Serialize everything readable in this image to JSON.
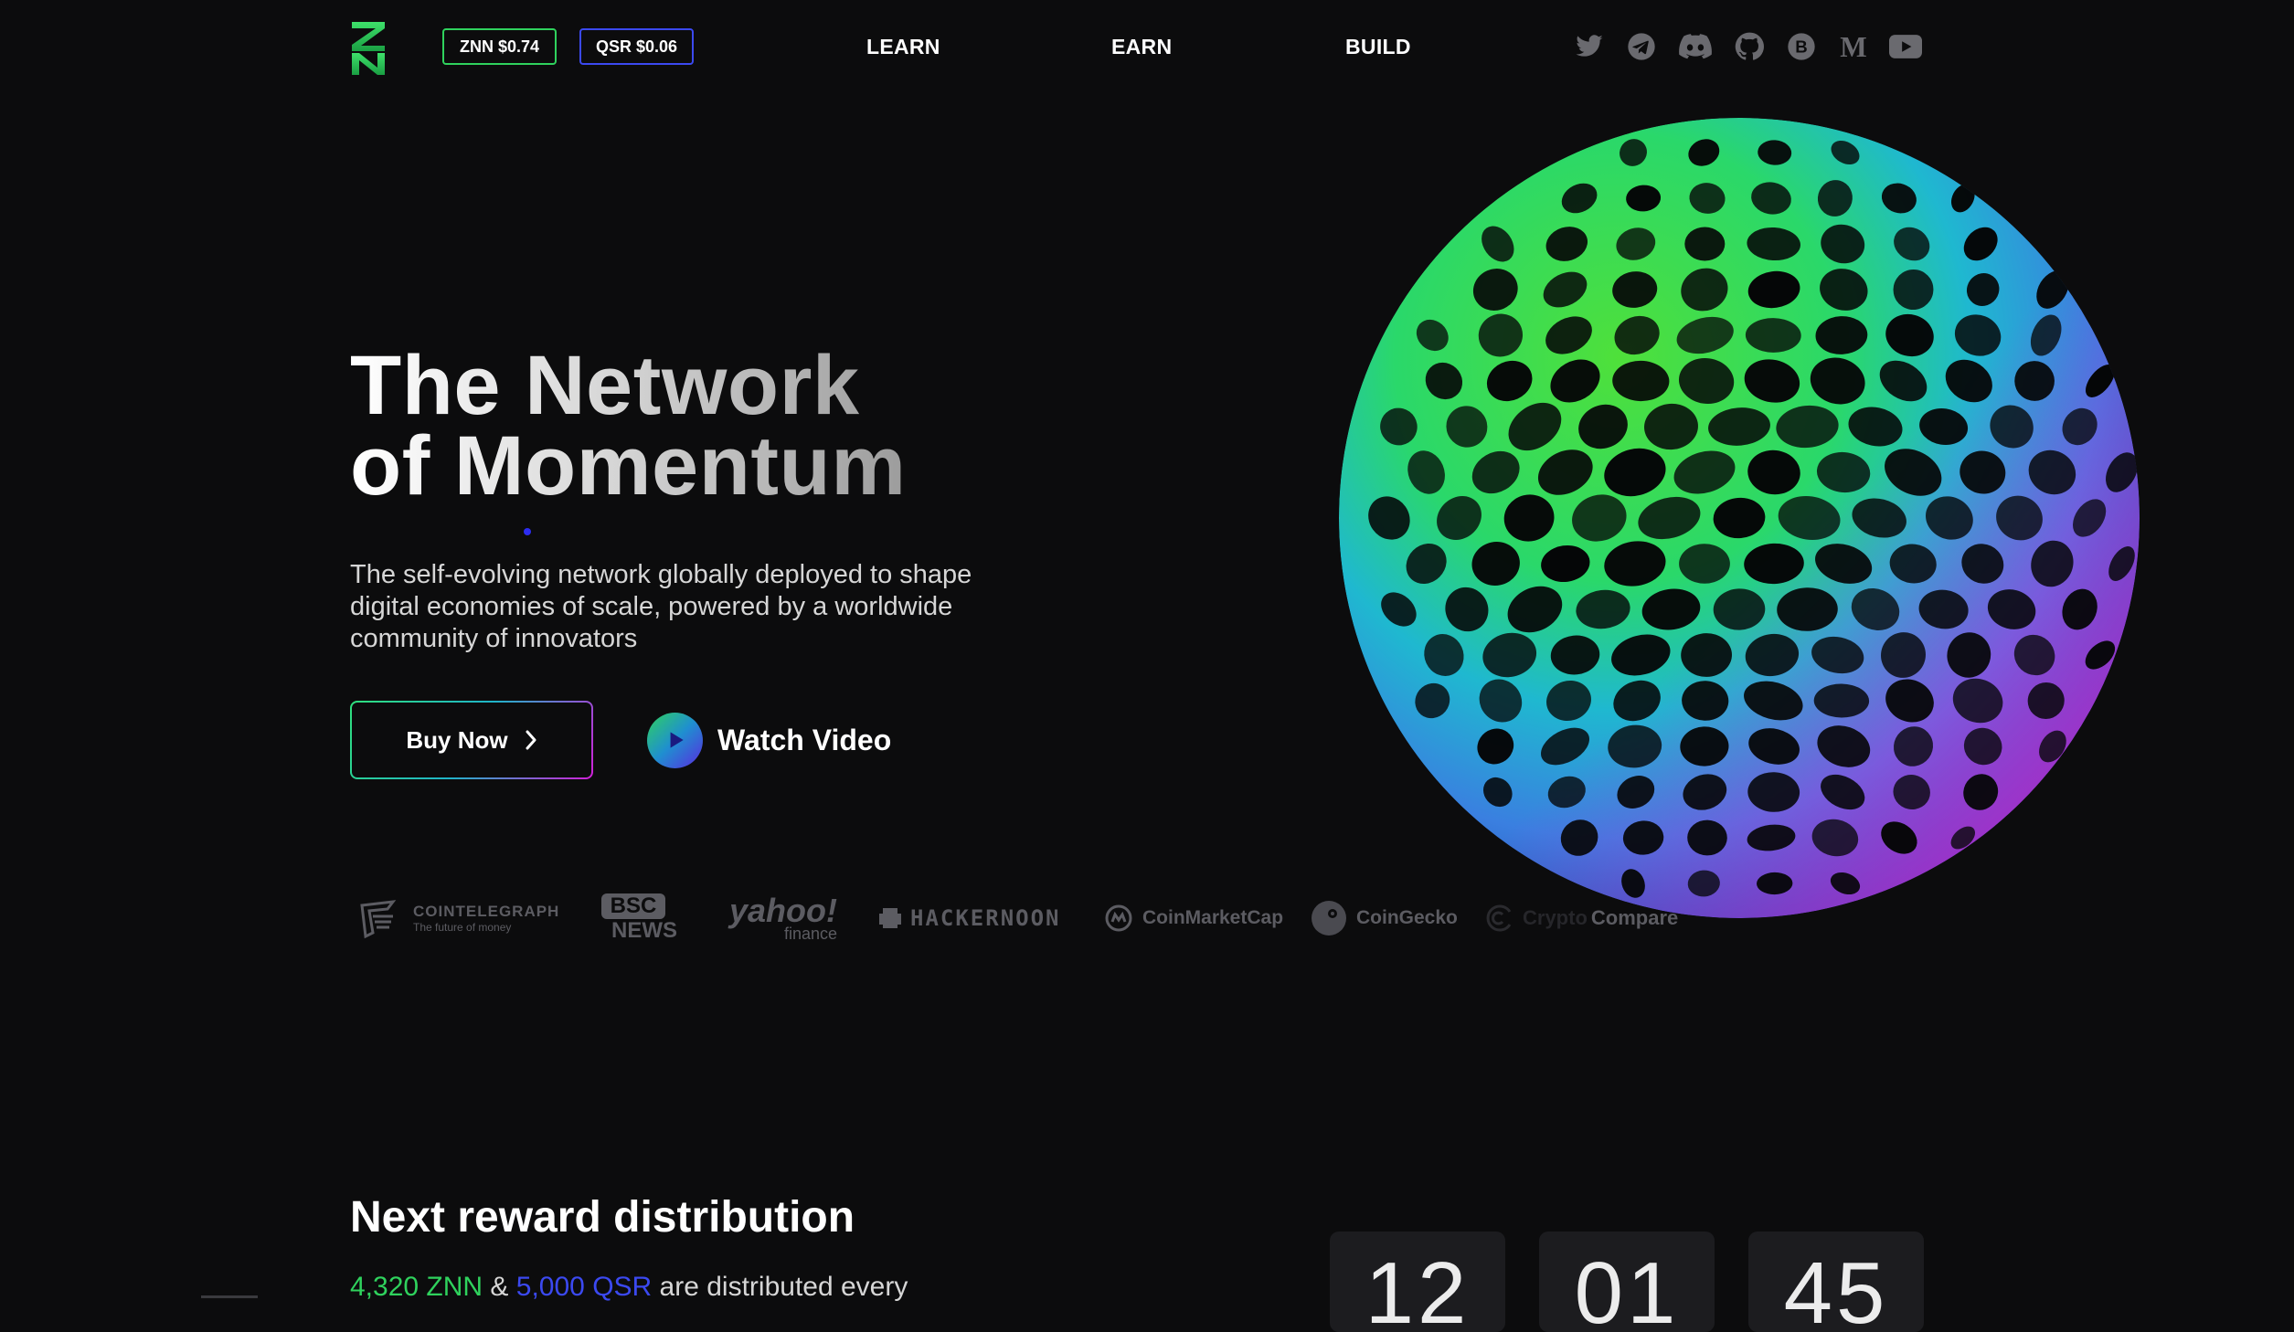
{
  "header": {
    "prices": {
      "znn": "ZNN $0.74",
      "qsr": "QSR $0.06"
    },
    "nav": [
      "LEARN",
      "EARN",
      "BUILD"
    ],
    "social_icons": [
      "twitter-icon",
      "telegram-icon",
      "discord-icon",
      "github-icon",
      "bitcointalk-icon",
      "medium-icon",
      "youtube-icon"
    ]
  },
  "hero": {
    "title_line1": "The Network",
    "title_line2": "of Momentum",
    "description": "The self-evolving network globally deployed to shape digital economies of scale, powered by a worldwide community of innovators",
    "buy_label": "Buy Now",
    "watch_label": "Watch Video"
  },
  "press": {
    "cointelegraph": "COINTELEGRAPH",
    "cointelegraph_tag": "The future of money",
    "bsc_top": "BSC",
    "bsc_bottom": "NEWS",
    "yahoo": "yahoo!",
    "yahoo_sub": "finance",
    "hackernoon": "HACKERNOON",
    "coinmarketcap": "CoinMarketCap",
    "coingecko": "CoinGecko",
    "cryptocompare_a": "Crypto",
    "cryptocompare_b": "Compare"
  },
  "reward": {
    "title": "Next reward distribution",
    "znn_amount": "4,320 ZNN",
    "amp": "&",
    "qsr_amount": "5,000 QSR",
    "desc_rest": "are distributed every",
    "countdown": [
      "12",
      "01",
      "45"
    ]
  },
  "colors": {
    "background": "#0c0c0d",
    "znn_green": "#2fd25d",
    "qsr_blue": "#3b49f0",
    "accent_magenta": "#d21fd8"
  }
}
